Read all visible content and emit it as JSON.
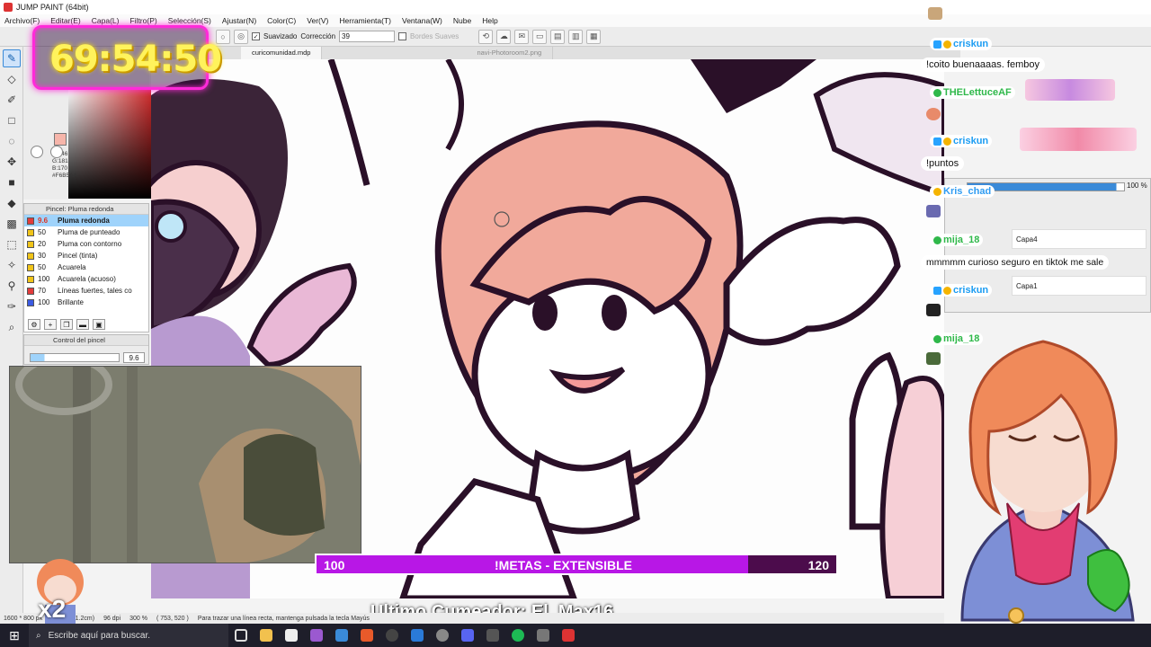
{
  "app": {
    "title": "JUMP PAINT (64bit)"
  },
  "menu": [
    "Archivo(F)",
    "Editar(E)",
    "Capa(L)",
    "Filtro(P)",
    "Selección(S)",
    "Ajustar(N)",
    "Color(C)",
    "Ver(V)",
    "Herramienta(T)",
    "Ventana(W)",
    "Nube",
    "Help"
  ],
  "toolbar": {
    "smoothing_label": "Suavizado",
    "correction_label": "Corrección",
    "correction_value": "39",
    "soft_edges_label": "Bordes Suaves"
  },
  "timer": {
    "value": "69:54:50"
  },
  "color": {
    "r": "R:246",
    "g": "G:181",
    "b": "B:170",
    "hex": "#F6B5AA",
    "current": "#F6B5AA"
  },
  "brush_panel": {
    "title": "Pincel: Pluma redonda",
    "items": [
      {
        "size": "9.6",
        "name": "Pluma redonda",
        "color": "#e33b3b",
        "selected": true
      },
      {
        "size": "50",
        "name": "Pluma de punteado",
        "color": "#f0c419"
      },
      {
        "size": "20",
        "name": "Pluma con contorno",
        "color": "#f0c419"
      },
      {
        "size": "30",
        "name": "Pincel (tinta)",
        "color": "#f0c419"
      },
      {
        "size": "50",
        "name": "Acuarela",
        "color": "#f0c419"
      },
      {
        "size": "100",
        "name": "Acuarela (acuoso)",
        "color": "#f0c419"
      },
      {
        "size": "70",
        "name": "Líneas fuertes, tales co",
        "color": "#e33b3b"
      },
      {
        "size": "100",
        "name": "Brillante",
        "color": "#3b5be3"
      }
    ]
  },
  "brush_control": {
    "title": "Control del pincel",
    "value": "9.6",
    "fill_fraction": 0.16
  },
  "tabs": [
    {
      "label": "curicomunidad.mdp",
      "active": true
    },
    {
      "label": "navi-Photoroom2.png",
      "active": false
    }
  ],
  "goal": {
    "current": "100",
    "label": "!METAS - EXTENSIBLE",
    "target": "120",
    "progress": 0.83
  },
  "last_cum": {
    "text": "Ultimo Cumeador: El_Max16"
  },
  "status": {
    "size": "1600 * 800 px",
    "cm": "(42.3 * 21.2cm)",
    "dpi": "96 dpi",
    "zoom": "300 %",
    "coords": "( 753, 520 )",
    "hint": "Para trazar una línea recta, mantenga pulsada la tecla Mayús"
  },
  "chat": [
    {
      "user": "criskun",
      "message": "!coito buenaaaas. femboy",
      "color": "#1b9cf2"
    },
    {
      "user": "THELettuceAF",
      "message": "",
      "color": "#2fb84a"
    },
    {
      "user": "criskun",
      "message": "!puntos",
      "color": "#1b9cf2"
    },
    {
      "user": "Kris_chad",
      "message": "",
      "color": "#2f9cf2"
    },
    {
      "user": "mija_18",
      "message": "mmmmm curioso seguro en tiktok me sale",
      "color": "#2fb84a"
    },
    {
      "user": "criskun",
      "message": "",
      "color": "#1b9cf2"
    },
    {
      "user": "mija_18",
      "message": "",
      "color": "#2fb84a"
    }
  ],
  "layers": {
    "opacity": "100 %",
    "opacity_fraction": 0.95,
    "items": [
      "Capa4",
      "Capa1"
    ]
  },
  "taskbar": {
    "search_placeholder": "Escribe aquí para buscar."
  },
  "multiplier": {
    "text": "x2"
  }
}
